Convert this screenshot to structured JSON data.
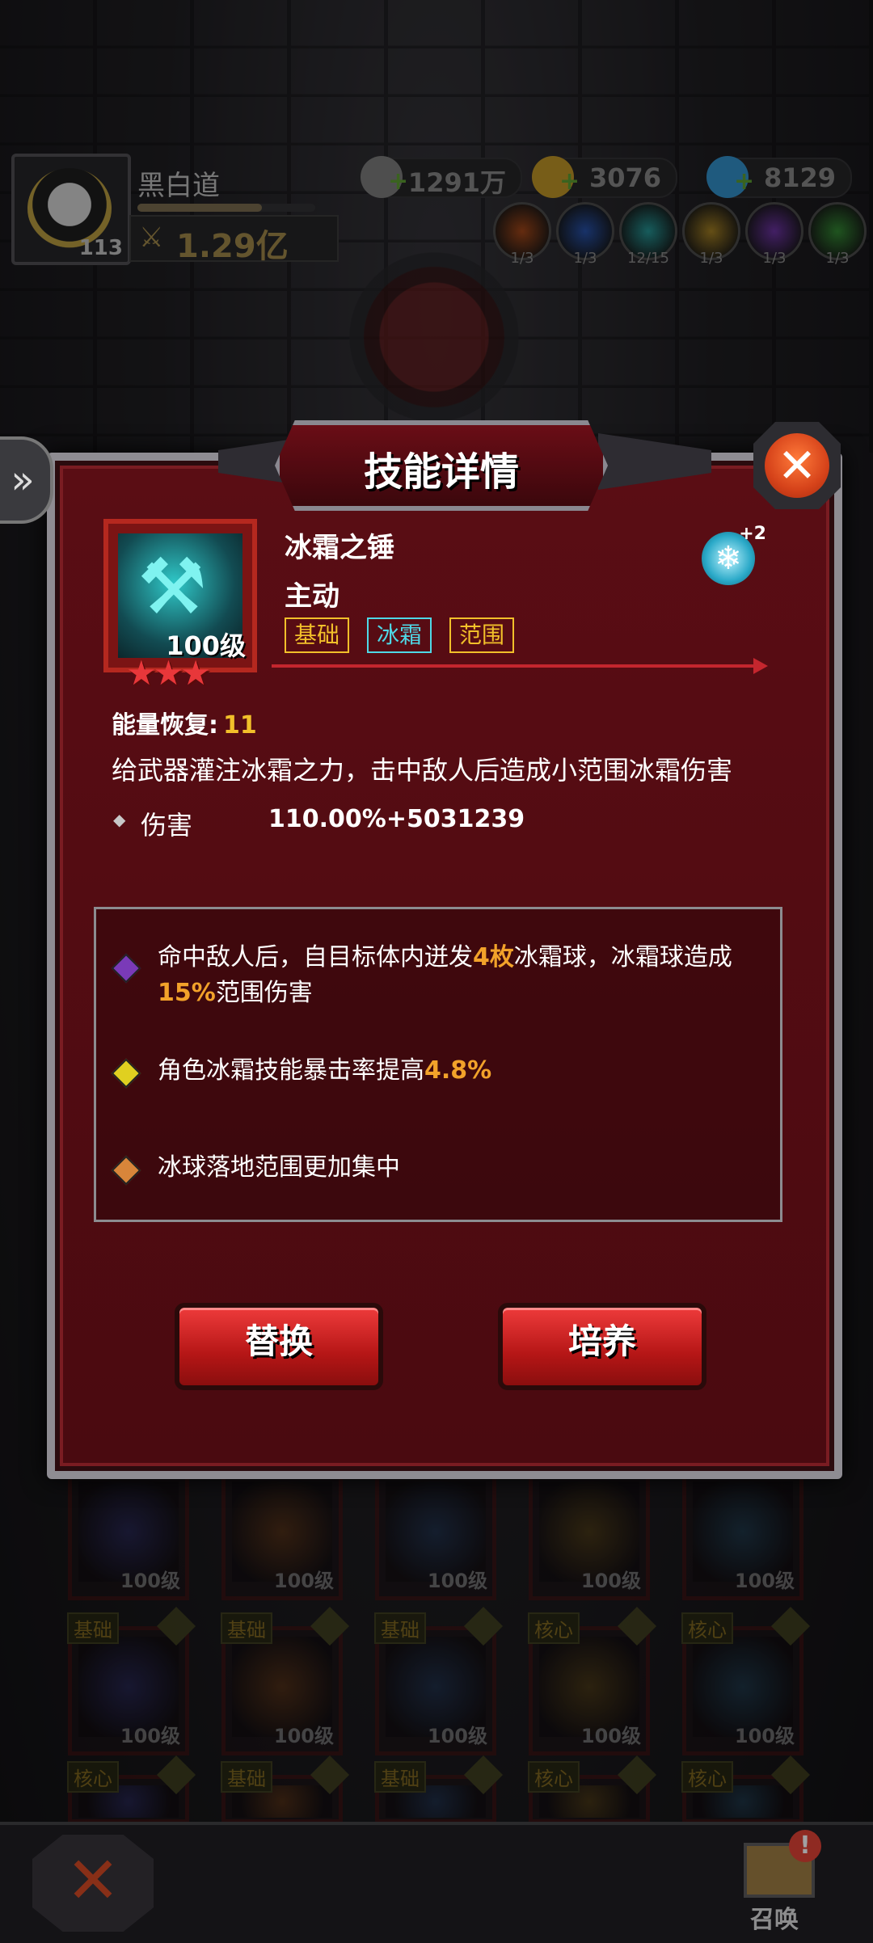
{
  "player": {
    "name": "黑白道",
    "level": "113",
    "power": "1.29亿",
    "exp_fraction": 0.7
  },
  "resources": [
    {
      "icon": "silver-coin-icon",
      "value": "1291万",
      "color": "#8f8f8f"
    },
    {
      "icon": "gold-coin-icon",
      "value": "3076",
      "color": "#d9a92c"
    },
    {
      "icon": "diamond-icon",
      "value": "8129",
      "color": "#3aa5e6"
    }
  ],
  "elements": [
    {
      "icon": "fire-element-icon",
      "count": "1/3",
      "color": "#b8501c"
    },
    {
      "icon": "lightning-element-icon",
      "count": "1/3",
      "color": "#2c5cc0"
    },
    {
      "icon": "ice-element-icon",
      "count": "12/15",
      "color": "#2aa9a9"
    },
    {
      "icon": "light-element-icon",
      "count": "1/3",
      "color": "#b89028"
    },
    {
      "icon": "dark-element-icon",
      "count": "1/3",
      "color": "#7a3ab8"
    },
    {
      "icon": "poison-element-icon",
      "count": "1/3",
      "color": "#3a9a3a"
    }
  ],
  "dialog": {
    "title": "技能详情",
    "skill": {
      "name": "冰霜之锤",
      "type": "主动",
      "level": "100级",
      "stars": "★★★",
      "badge_plus": "+2",
      "tags": [
        "基础",
        "冰霜",
        "范围"
      ]
    },
    "energy_label": "能量恢复:",
    "energy_value": "11",
    "description": "给武器灌注冰霜之力，击中敌人后造成小范围冰霜伤害",
    "damage_label": "伤害",
    "damage_value": "110.00%+5031239",
    "effects": [
      {
        "color": "#7a3ab8",
        "pre": "命中敌人后，自目标体内迸发",
        "hl1": "4枚",
        "mid": "冰霜球，冰霜球造成",
        "hl2": "15%",
        "post": "范围伤害"
      },
      {
        "color": "#e0d020",
        "pre": "角色冰霜技能暴击率提高",
        "hl1": "4.8%"
      },
      {
        "color": "#d8853a",
        "pre": "冰球落地范围更加集中"
      }
    ],
    "buttons": {
      "replace": "替换",
      "upgrade": "培养"
    }
  },
  "grid_rows": [
    [
      {
        "tag": "",
        "level": "100级"
      },
      {
        "tag": "",
        "level": "100级"
      },
      {
        "tag": "",
        "level": "100级"
      },
      {
        "tag": "",
        "level": "100级"
      },
      {
        "tag": "",
        "level": "100级"
      }
    ],
    [
      {
        "tag": "基础",
        "level": "100级"
      },
      {
        "tag": "基础",
        "level": "100级"
      },
      {
        "tag": "基础",
        "level": "100级"
      },
      {
        "tag": "核心",
        "level": "100级"
      },
      {
        "tag": "核心",
        "level": "100级"
      }
    ],
    [
      {
        "tag": "核心",
        "level": ""
      },
      {
        "tag": "基础",
        "level": ""
      },
      {
        "tag": "基础",
        "level": ""
      },
      {
        "tag": "核心",
        "level": ""
      },
      {
        "tag": "核心",
        "level": ""
      }
    ]
  ],
  "bottom": {
    "summon_label": "召唤",
    "alert": "!"
  }
}
